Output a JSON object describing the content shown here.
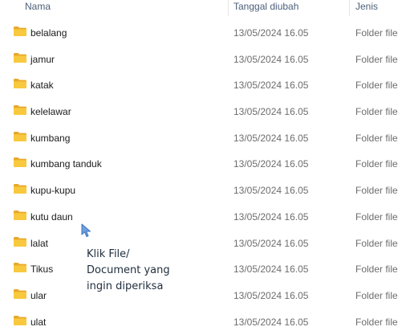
{
  "columns": {
    "name": "Nama",
    "date": "Tanggal diubah",
    "type": "Jenis"
  },
  "rows": [
    {
      "name": "belalang",
      "date": "13/05/2024 16.05",
      "type": "Folder file"
    },
    {
      "name": "jamur",
      "date": "13/05/2024 16.05",
      "type": "Folder file"
    },
    {
      "name": "katak",
      "date": "13/05/2024 16.05",
      "type": "Folder file"
    },
    {
      "name": "kelelawar",
      "date": "13/05/2024 16.05",
      "type": "Folder file"
    },
    {
      "name": "kumbang",
      "date": "13/05/2024 16.05",
      "type": "Folder file"
    },
    {
      "name": "kumbang tanduk",
      "date": "13/05/2024 16.05",
      "type": "Folder file"
    },
    {
      "name": "kupu-kupu",
      "date": "13/05/2024 16.05",
      "type": "Folder file"
    },
    {
      "name": "kutu daun",
      "date": "13/05/2024 16.05",
      "type": "Folder file"
    },
    {
      "name": "lalat",
      "date": "13/05/2024 16.05",
      "type": "Folder file"
    },
    {
      "name": "Tikus",
      "date": "13/05/2024 16.05",
      "type": "Folder file"
    },
    {
      "name": "ular",
      "date": "13/05/2024 16.05",
      "type": "Folder file"
    },
    {
      "name": "ulat",
      "date": "13/05/2024 16.05",
      "type": "Folder file"
    }
  ],
  "annotation": {
    "line1": "Klik File/",
    "line2": "Document yang",
    "line3": "ingin diperiksa"
  },
  "icons": {
    "row_icon": "folder-icon",
    "pointer": "mouse-pointer-icon"
  },
  "colors": {
    "folder": "#f8c93e",
    "folder_dark": "#e8a92b",
    "cursor": "#5b8fd6"
  }
}
